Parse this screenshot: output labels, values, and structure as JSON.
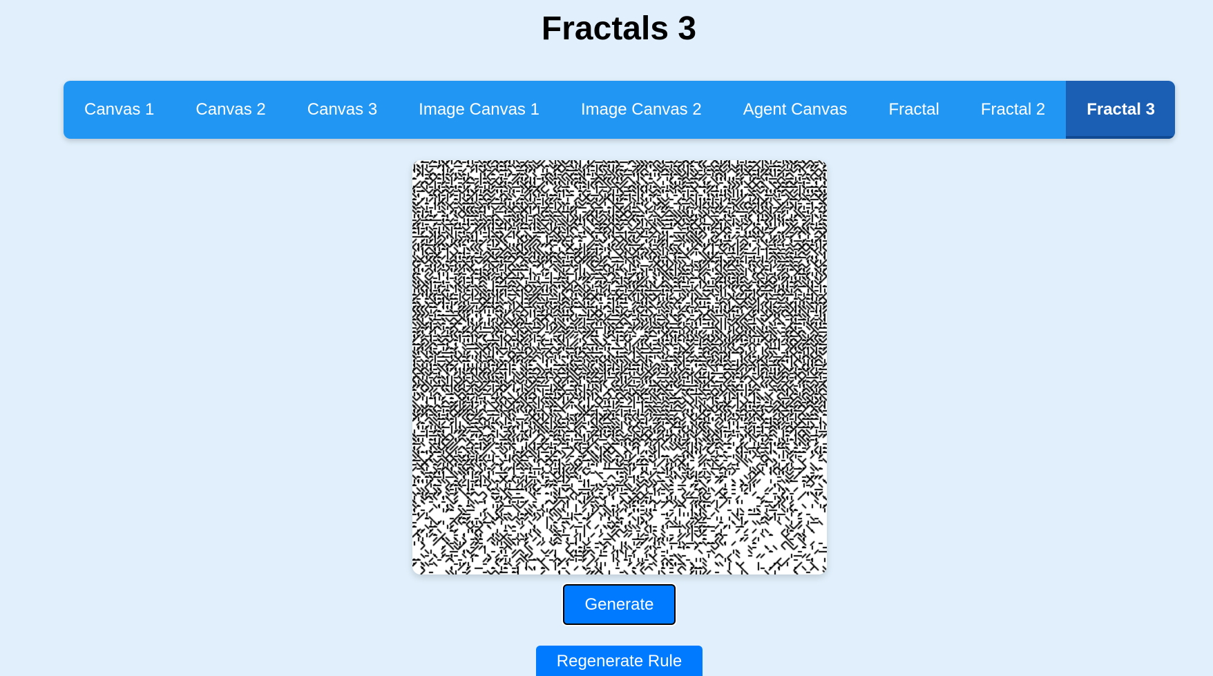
{
  "page": {
    "title": "Fractals 3"
  },
  "nav": {
    "items": [
      {
        "label": "Canvas 1",
        "active": false
      },
      {
        "label": "Canvas 2",
        "active": false
      },
      {
        "label": "Canvas 3",
        "active": false
      },
      {
        "label": "Image Canvas 1",
        "active": false
      },
      {
        "label": "Image Canvas 2",
        "active": false
      },
      {
        "label": "Agent Canvas",
        "active": false
      },
      {
        "label": "Fractal",
        "active": false
      },
      {
        "label": "Fractal 2",
        "active": false
      },
      {
        "label": "Fractal 3",
        "active": true
      }
    ]
  },
  "controls": {
    "generate_label": "Generate",
    "regenerate_label": "Regenerate Rule"
  },
  "colors": {
    "background": "#e0effb",
    "nav": "#2196f3",
    "nav_active": "#1a5fb4",
    "button": "#007bff"
  }
}
